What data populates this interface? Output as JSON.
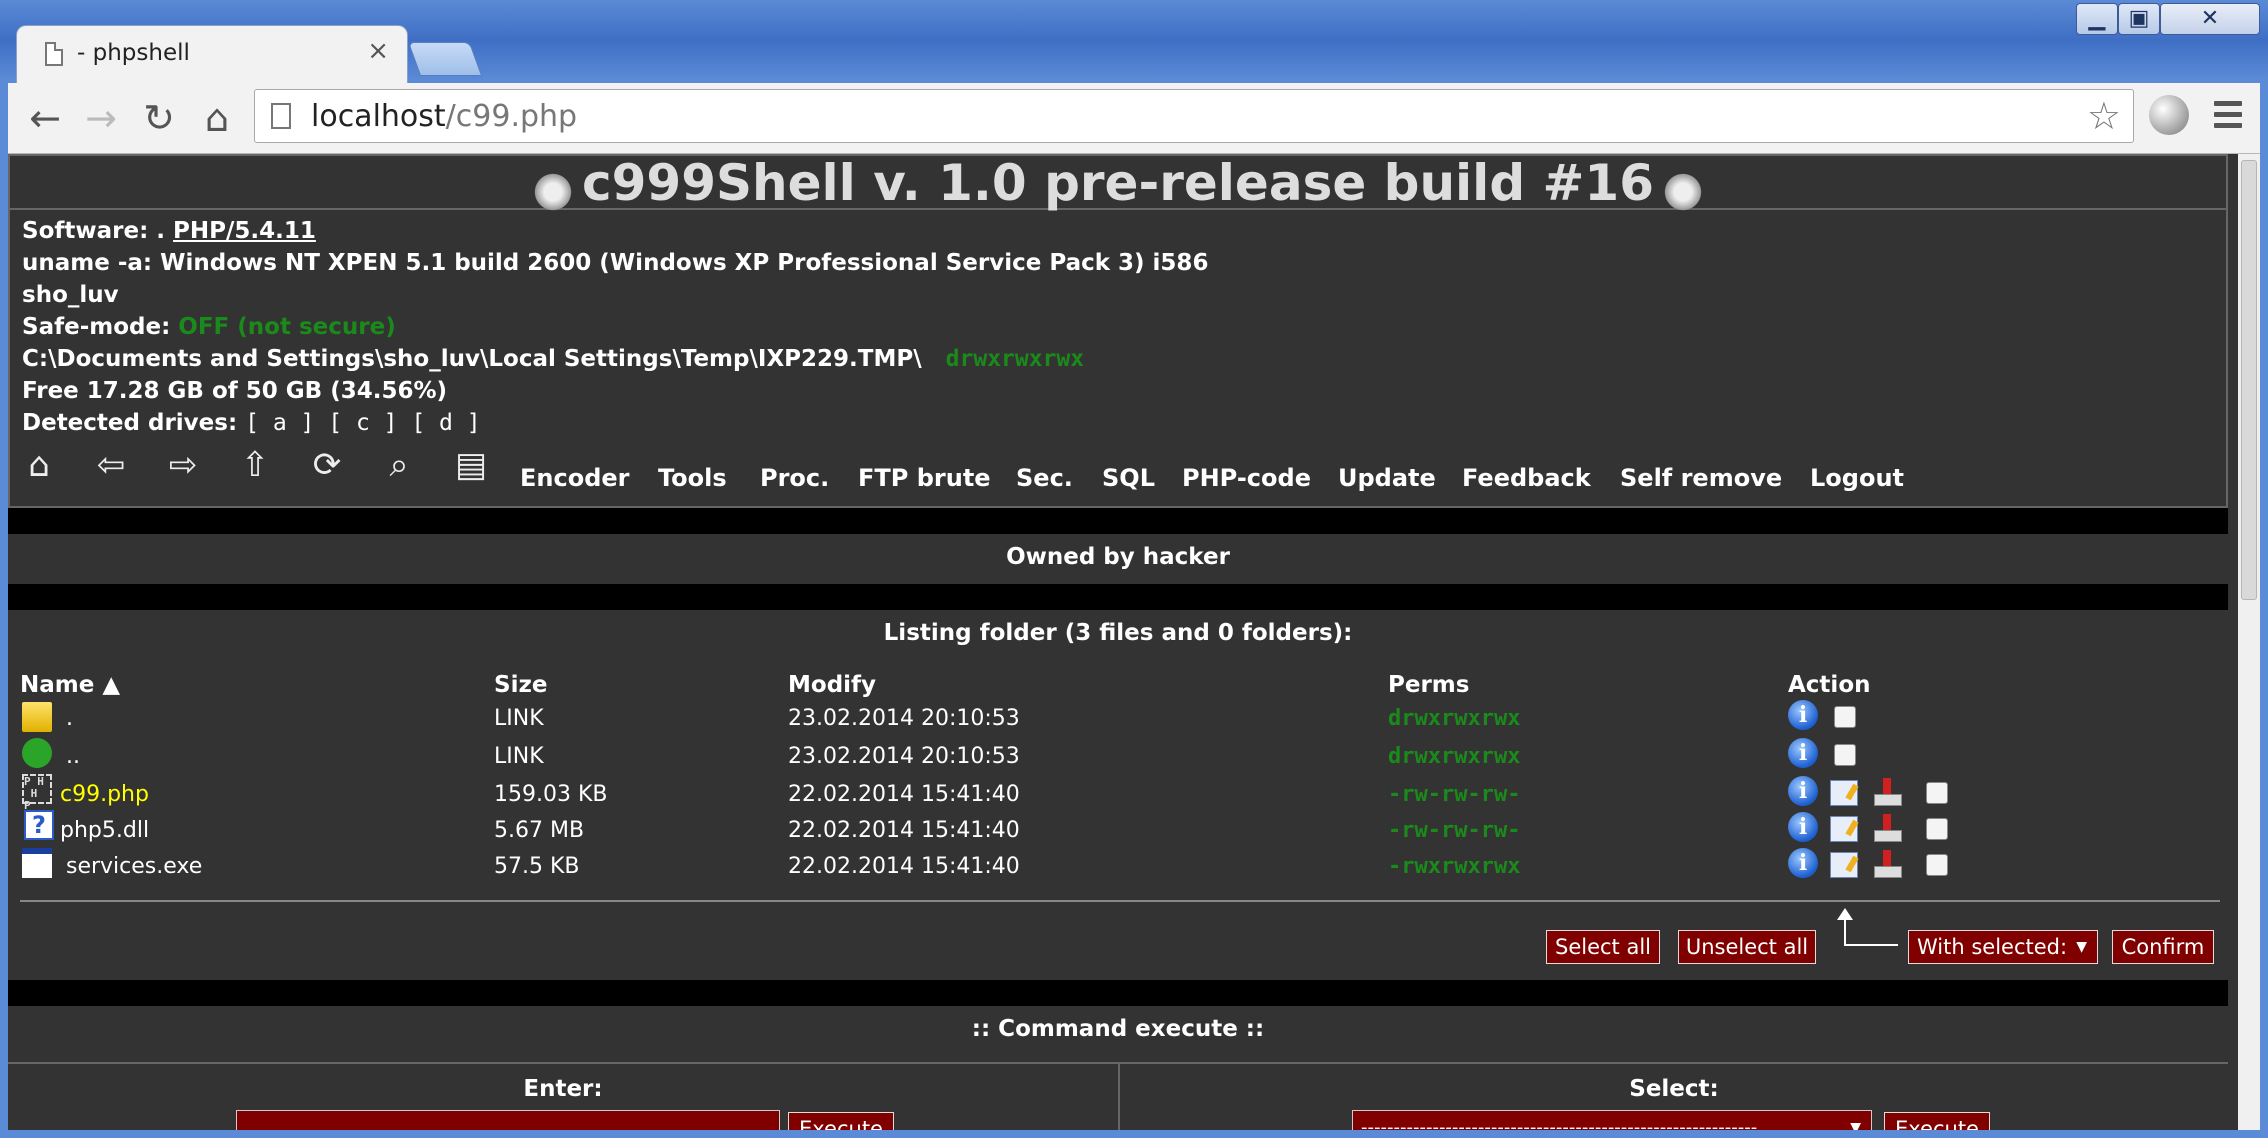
{
  "browser": {
    "tab_title": "- phpshell",
    "tab_close": "×",
    "url_host": "localhost",
    "url_path": "/c99.php"
  },
  "shell": {
    "title": "c999Shell v. 1.0 pre-release build #16",
    "software_label": "Software: .",
    "software_value": "PHP/5.4.11",
    "uname": "uname -a: Windows NT XPEN 5.1 build 2600 (Windows XP Professional Service Pack 3) i586",
    "user": "sho_luv",
    "safe_mode_label": "Safe-mode:",
    "safe_mode_value": "OFF (not secure)",
    "path": "C:\\Documents and Settings\\sho_luv\\Local Settings\\Temp\\IXP229.TMP\\",
    "path_perms": "drwxrwxrwx",
    "free": "Free 17.28 GB of 50 GB (34.56%)",
    "drives_label": "Detected drives:",
    "drives": "[ a ] [ c ] [ d ]",
    "menu": [
      "Encoder",
      "Tools",
      "Proc.",
      "FTP brute",
      "Sec.",
      "SQL",
      "PHP-code",
      "Update",
      "Feedback",
      "Self remove",
      "Logout"
    ]
  },
  "owned": "Owned by hacker",
  "listing": {
    "title": "Listing folder (3 files and 0 folders):",
    "columns": {
      "name": "Name ▲",
      "size": "Size",
      "modify": "Modify",
      "perms": "Perms",
      "action": "Action"
    },
    "rows": [
      {
        "name": ".",
        "size": "LINK",
        "modify": "23.02.2014 20:10:53",
        "perms": "drwxrwxrwx"
      },
      {
        "name": "..",
        "size": "LINK",
        "modify": "23.02.2014 20:10:53",
        "perms": "drwxrwxrwx"
      },
      {
        "name": "c99.php",
        "size": "159.03 KB",
        "modify": "22.02.2014 15:41:40",
        "perms": "-rw-rw-rw-"
      },
      {
        "name": "php5.dll",
        "size": "5.67 MB",
        "modify": "22.02.2014 15:41:40",
        "perms": "-rw-rw-rw-"
      },
      {
        "name": "services.exe",
        "size": "57.5 KB",
        "modify": "22.02.2014 15:41:40",
        "perms": "-rwxrwxrwx"
      }
    ],
    "select_all": "Select all",
    "unselect_all": "Unselect all",
    "with_selected": "With selected:",
    "confirm": "Confirm"
  },
  "command": {
    "title": ":: Command execute ::",
    "enter_label": "Enter:",
    "select_label": "Select:",
    "execute": "Execute",
    "select_placeholder": "-------------------------------------------------------------"
  },
  "colors": {
    "bg": "#333333",
    "green": "#1a8a1a",
    "button": "#800000",
    "yellow_link": "#ffff00"
  }
}
